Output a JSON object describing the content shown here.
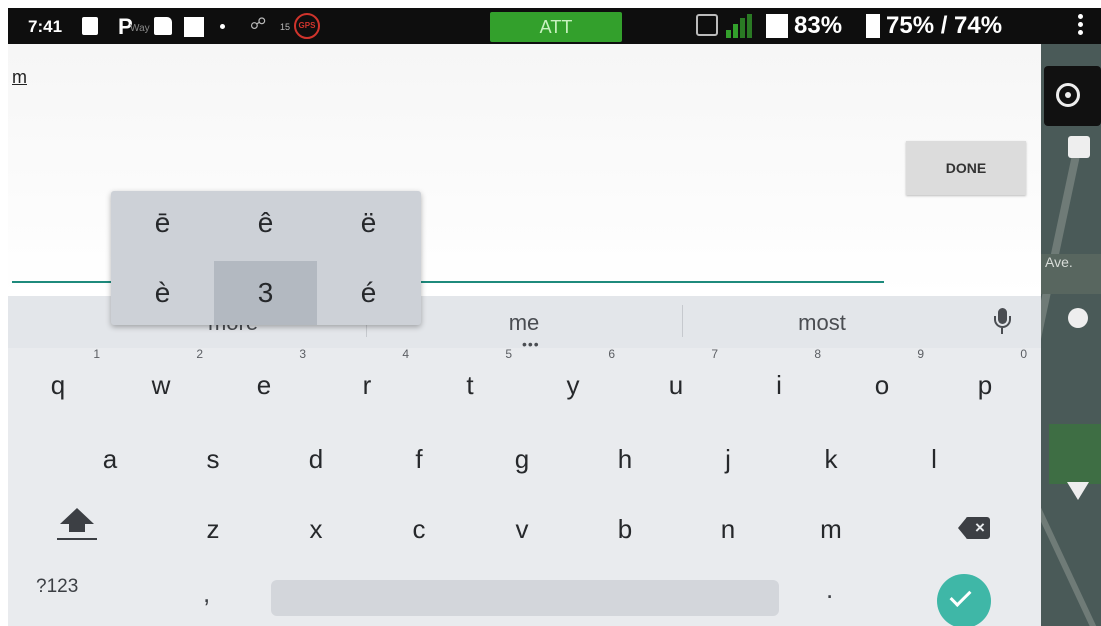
{
  "status_bar": {
    "time": "7:41",
    "p_label": "P",
    "waypoint_text": "Way",
    "sat_count": "15",
    "gps_label": "GPS",
    "carrier": "ATT",
    "battery1": "83%",
    "battery2": "75% / 74%"
  },
  "input": {
    "text": "m",
    "done_label": "DONE"
  },
  "map": {
    "street_fragment": "Ave."
  },
  "accent_popup": {
    "row1": [
      "ē",
      "ê",
      "ë"
    ],
    "row2": [
      "è",
      "3",
      "é"
    ],
    "selected": "3"
  },
  "suggestions": {
    "items": [
      "more",
      "me",
      "most"
    ],
    "dots": "•••"
  },
  "keyboard": {
    "row1": [
      {
        "label": "q",
        "hint": "1"
      },
      {
        "label": "w",
        "hint": "2"
      },
      {
        "label": "e",
        "hint": "3"
      },
      {
        "label": "r",
        "hint": "4"
      },
      {
        "label": "t",
        "hint": "5"
      },
      {
        "label": "y",
        "hint": "6"
      },
      {
        "label": "u",
        "hint": "7"
      },
      {
        "label": "i",
        "hint": "8"
      },
      {
        "label": "o",
        "hint": "9"
      },
      {
        "label": "p",
        "hint": "0"
      }
    ],
    "row2": [
      "a",
      "s",
      "d",
      "f",
      "g",
      "h",
      "j",
      "k",
      "l"
    ],
    "row3": [
      "z",
      "x",
      "c",
      "v",
      "b",
      "n",
      "m"
    ],
    "symbols_label": "?123",
    "comma": ",",
    "period": ".",
    "backspace_glyph": "×"
  },
  "colors": {
    "accent_teal": "#1e8a7c",
    "enter_teal": "#3fb7a7",
    "att_green": "#33a02c",
    "gps_red": "#d0342c"
  }
}
